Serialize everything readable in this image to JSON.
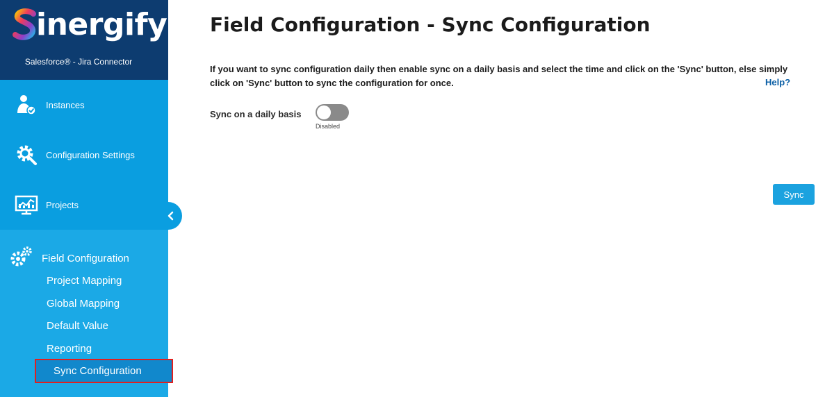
{
  "brand": {
    "name": "inergify",
    "trademark": "™",
    "subtitle": "Salesforce® - Jira Connector"
  },
  "sidebar": {
    "items": [
      {
        "label": "Instances",
        "icon": "user-check-icon"
      },
      {
        "label": "Configuration Settings",
        "icon": "gear-wrench-icon"
      },
      {
        "label": "Projects",
        "icon": "chart-monitor-icon"
      }
    ],
    "collapse_icon": "chevron-left-icon",
    "field_configuration": {
      "label": "Field Configuration",
      "icon": "gears-icon",
      "sub_items": [
        "Project Mapping",
        "Global Mapping",
        "Default Value",
        "Reporting",
        "Sync Configuration"
      ],
      "active": "Sync Configuration"
    }
  },
  "main": {
    "title": "Field Configuration - Sync Configuration",
    "description": "If you want to sync configuration daily then enable sync on a daily basis and select the time and click on the 'Sync' button, else simply click on 'Sync' button to sync the configuration for once.",
    "help_label": "Help?",
    "toggle_label": "Sync on a daily basis",
    "toggle_state": "Disabled",
    "sync_button": "Sync"
  },
  "colors": {
    "brand_bg": "#0d3c70",
    "sidebar_bg": "#1ba2df",
    "active_outline": "#e02020",
    "link": "#0b5fa5"
  }
}
